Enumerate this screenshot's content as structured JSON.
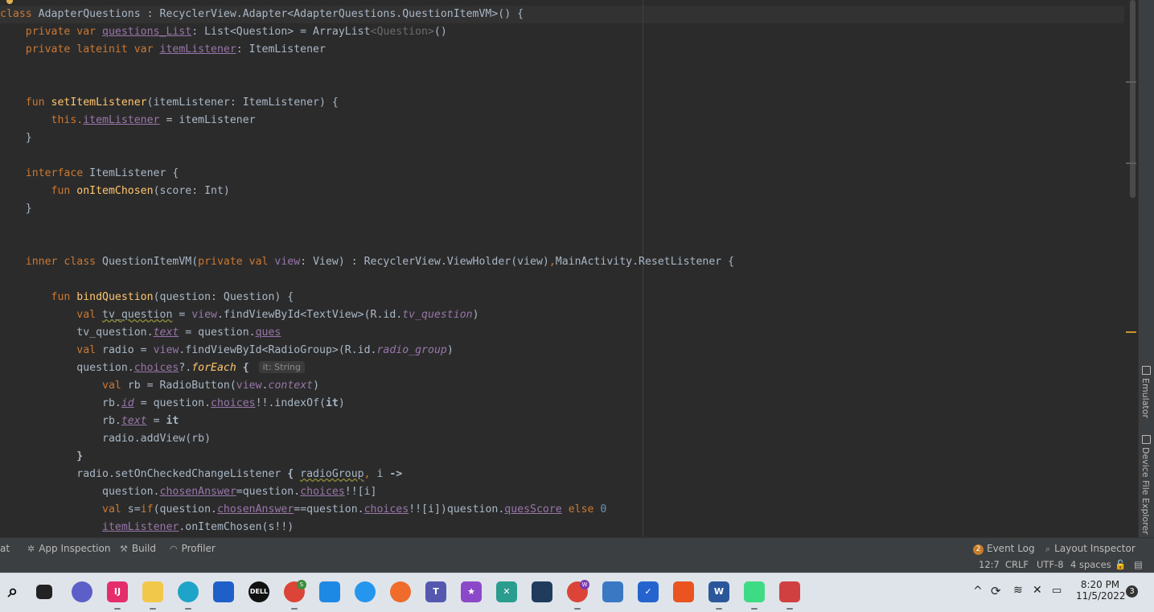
{
  "editor": {
    "lines": [
      [
        {
          "t": "class ",
          "c": "kw"
        },
        {
          "t": "AdapterQuestions",
          "c": "cls"
        },
        {
          "t": " : RecyclerView.Adapter<AdapterQuestions.QuestionItemVM>() {",
          "c": "cls"
        }
      ],
      [
        {
          "t": "    private var ",
          "c": "kw"
        },
        {
          "t": "questions_List",
          "c": "prop ul"
        },
        {
          "t": ": List<Question> = ArrayList",
          "c": ""
        },
        {
          "t": "<Question>",
          "c": "gray"
        },
        {
          "t": "()",
          "c": ""
        }
      ],
      [
        {
          "t": "    private lateinit var ",
          "c": "kw"
        },
        {
          "t": "itemListener",
          "c": "prop ul"
        },
        {
          "t": ": ItemListener",
          "c": ""
        }
      ],
      [],
      [],
      [
        {
          "t": "    fun ",
          "c": "kw"
        },
        {
          "t": "setItemListener",
          "c": "fn"
        },
        {
          "t": "(itemListener: ItemListener) {",
          "c": ""
        }
      ],
      [
        {
          "t": "        this.",
          "c": "kw"
        },
        {
          "t": "itemListener",
          "c": "prop ul"
        },
        {
          "t": " = itemListener",
          "c": ""
        }
      ],
      [
        {
          "t": "    }",
          "c": ""
        }
      ],
      [],
      [
        {
          "t": "    interface ",
          "c": "kw"
        },
        {
          "t": "ItemListener {",
          "c": ""
        }
      ],
      [
        {
          "t": "        fun ",
          "c": "kw"
        },
        {
          "t": "onItemChosen",
          "c": "fn"
        },
        {
          "t": "(score: Int)",
          "c": ""
        }
      ],
      [
        {
          "t": "    }",
          "c": ""
        }
      ],
      [],
      [],
      [
        {
          "t": "    inner class ",
          "c": "kw"
        },
        {
          "t": "QuestionItemVM(",
          "c": ""
        },
        {
          "t": "private val ",
          "c": "kw"
        },
        {
          "t": "view",
          "c": "prop"
        },
        {
          "t": ": View) : RecyclerView.ViewHolder(view)",
          "c": ""
        },
        {
          "t": ",",
          "c": "kw"
        },
        {
          "t": "MainActivity.ResetListener {",
          "c": ""
        }
      ],
      [],
      [
        {
          "t": "        fun ",
          "c": "kw"
        },
        {
          "t": "bindQuestion",
          "c": "fn"
        },
        {
          "t": "(question: Question) {",
          "c": ""
        }
      ],
      [
        {
          "t": "            val ",
          "c": "kw"
        },
        {
          "t": "tv_question",
          "c": "wavy"
        },
        {
          "t": " = ",
          "c": ""
        },
        {
          "t": "view",
          "c": "prop"
        },
        {
          "t": ".findViewById<TextView>(R.id.",
          "c": ""
        },
        {
          "t": "tv_question",
          "c": "prop ital"
        },
        {
          "t": ")",
          "c": ""
        }
      ],
      [
        {
          "t": "            tv_question.",
          "c": ""
        },
        {
          "t": "text",
          "c": "prop ital ul"
        },
        {
          "t": " = question.",
          "c": ""
        },
        {
          "t": "ques",
          "c": "prop ul"
        }
      ],
      [
        {
          "t": "            val ",
          "c": "kw"
        },
        {
          "t": "radio = ",
          "c": ""
        },
        {
          "t": "view",
          "c": "prop"
        },
        {
          "t": ".findViewById<RadioGroup>(R.id.",
          "c": ""
        },
        {
          "t": "radio_group",
          "c": "prop ital"
        },
        {
          "t": ")",
          "c": ""
        }
      ],
      [
        {
          "t": "            question.",
          "c": ""
        },
        {
          "t": "choices",
          "c": "prop ul"
        },
        {
          "t": "?.",
          "c": ""
        },
        {
          "t": "forEach",
          "c": "fn ital"
        },
        {
          "t": " { ",
          "c": "bold"
        },
        {
          "t": "it: String",
          "c": "hint"
        }
      ],
      [
        {
          "t": "                val ",
          "c": "kw"
        },
        {
          "t": "rb = RadioButton(",
          "c": ""
        },
        {
          "t": "view",
          "c": "prop"
        },
        {
          "t": ".",
          "c": ""
        },
        {
          "t": "context",
          "c": "prop ital"
        },
        {
          "t": ")",
          "c": ""
        }
      ],
      [
        {
          "t": "                rb.",
          "c": ""
        },
        {
          "t": "id",
          "c": "prop ital ul"
        },
        {
          "t": " = question.",
          "c": ""
        },
        {
          "t": "choices",
          "c": "prop ul"
        },
        {
          "t": "!!.indexOf(",
          "c": ""
        },
        {
          "t": "it",
          "c": "bold"
        },
        {
          "t": ")",
          "c": ""
        }
      ],
      [
        {
          "t": "                rb.",
          "c": ""
        },
        {
          "t": "text",
          "c": "prop ital ul"
        },
        {
          "t": " = ",
          "c": ""
        },
        {
          "t": "it",
          "c": "bold"
        }
      ],
      [
        {
          "t": "                radio.addView(rb)",
          "c": ""
        }
      ],
      [
        {
          "t": "            }",
          "c": "bold"
        }
      ],
      [
        {
          "t": "            radio.setOnCheckedChangeListener ",
          "c": ""
        },
        {
          "t": "{ ",
          "c": "bold"
        },
        {
          "t": "radioGroup",
          "c": "wavy"
        },
        {
          "t": ", ",
          "c": "kw"
        },
        {
          "t": "i ",
          "c": ""
        },
        {
          "t": "->",
          "c": "bold"
        }
      ],
      [
        {
          "t": "                question.",
          "c": ""
        },
        {
          "t": "chosenAnswer",
          "c": "prop ul"
        },
        {
          "t": "=question.",
          "c": ""
        },
        {
          "t": "choices",
          "c": "prop ul"
        },
        {
          "t": "!![i]",
          "c": ""
        }
      ],
      [
        {
          "t": "                val ",
          "c": "kw"
        },
        {
          "t": "s=",
          "c": ""
        },
        {
          "t": "if",
          "c": "kw"
        },
        {
          "t": "(question.",
          "c": ""
        },
        {
          "t": "chosenAnswer",
          "c": "prop ul"
        },
        {
          "t": "==question.",
          "c": ""
        },
        {
          "t": "choices",
          "c": "prop ul"
        },
        {
          "t": "!![i])question.",
          "c": ""
        },
        {
          "t": "quesScore",
          "c": "prop ul"
        },
        {
          "t": " else ",
          "c": "kw"
        },
        {
          "t": "0",
          "c": "num"
        }
      ],
      [
        {
          "t": "                ",
          "c": ""
        },
        {
          "t": "itemListener",
          "c": "prop ul"
        },
        {
          "t": ".onItemChosen(s!!)",
          "c": ""
        }
      ]
    ]
  },
  "right_tabs": {
    "emulator": "Emulator",
    "device_file_explorer": "Device File Explorer"
  },
  "tool_windows": {
    "cat": "at",
    "app_inspection": "App Inspection",
    "build": "Build",
    "profiler": "Profiler",
    "event_log": "Event Log",
    "event_count": "2",
    "layout_inspector": "Layout Inspector"
  },
  "status": {
    "position": "12:7",
    "line_sep": "CRLF",
    "encoding": "UTF-8",
    "indent": "4 spaces"
  },
  "taskbar": {
    "apps": [
      {
        "name": "chrome-s",
        "badge": "S",
        "color": "#3b8d3b"
      },
      {
        "name": "chrome-w",
        "badge": "W",
        "color": "#7a3bb0"
      }
    ],
    "time": "8:20 PM",
    "date": "11/5/2022",
    "notifications": "3"
  },
  "colors": {
    "editor_bg": "#2b2b2b",
    "keyword": "#cc7832",
    "function": "#ffc66d",
    "property": "#9876aa",
    "text": "#a9b7c6",
    "number": "#6897bb"
  }
}
